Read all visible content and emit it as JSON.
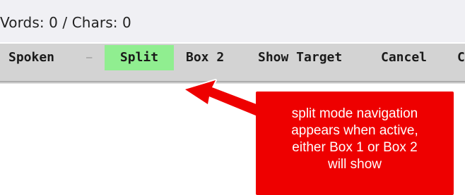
{
  "status": {
    "text": "Vords: 0 / Chars: 0"
  },
  "toolbar": {
    "spoken_label": "Spoken",
    "separator": "–",
    "split_label": "Split",
    "box2_label": "Box 2",
    "show_target_label": "Show Target",
    "cancel_label": "Cancel",
    "clipped_label": "C",
    "split_active_color": "#90ee90",
    "background_color": "#d3d3d3"
  },
  "annotation": {
    "line1": "split mode navigation",
    "line2": "appears when active,",
    "line3": "either Box 1 or Box 2",
    "line4": "will show",
    "color": "#ee0000",
    "arrow_icon": "red-arrow-icon"
  }
}
